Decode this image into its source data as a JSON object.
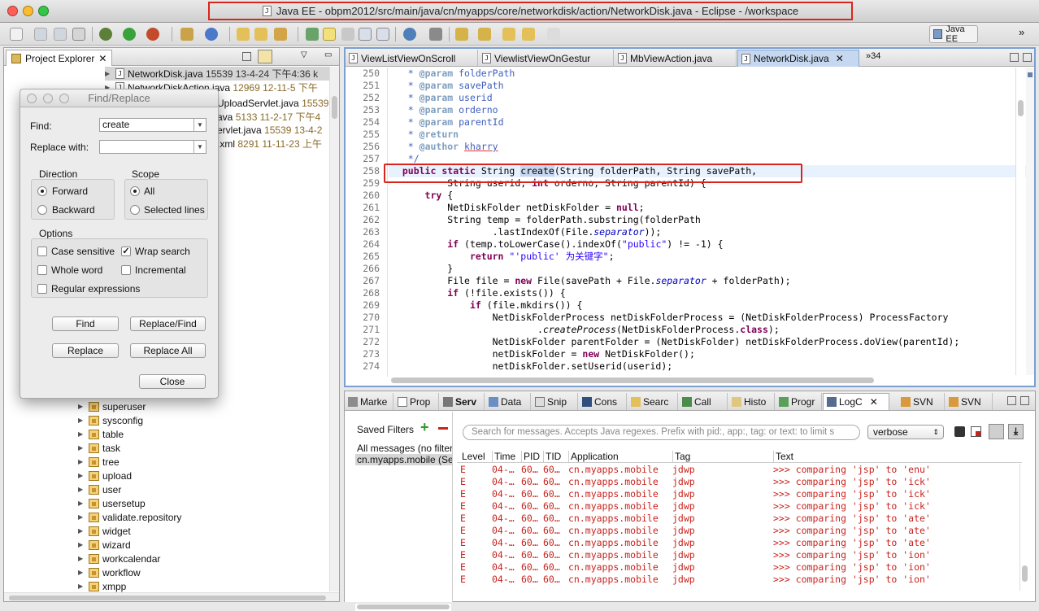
{
  "window": {
    "title": "Java EE - obpm2012/src/main/java/cn/myapps/core/networkdisk/action/NetworkDisk.java - Eclipse - /workspace",
    "perspective": "Java EE"
  },
  "colors": {
    "accent_red": "#d9261c",
    "error_red": "#c8231d",
    "keyword": "#7f0055",
    "comment": "#3f5fbf"
  },
  "project_explorer": {
    "title": "Project Explorer",
    "files": [
      {
        "name": "NetworkDisk.java",
        "info": "15539  13-4-24 下午4:36  k"
      },
      {
        "name": "NetworkDiskAction.java",
        "info": "12969  12-11-5 下午"
      },
      {
        "name": "UploadServlet.java",
        "info": "15539"
      },
      {
        "name": "ava",
        "info": "5133  11-2-17 下午4"
      },
      {
        "name": "ervlet.java",
        "info": "15539  13-4-2"
      },
      {
        "name": ".xml",
        "info": "8291  11-11-23 上午"
      }
    ],
    "packages": [
      "superuser",
      "sysconfig",
      "table",
      "task",
      "tree",
      "upload",
      "user",
      "usersetup",
      "validate.repository",
      "widget",
      "wizard",
      "workcalendar",
      "workflow",
      "xmpp"
    ]
  },
  "find_dialog": {
    "title": "Find/Replace",
    "find_label": "Find:",
    "find_value": "create",
    "replace_label": "Replace with:",
    "replace_value": "",
    "direction_label": "Direction",
    "forward": "Forward",
    "backward": "Backward",
    "scope_label": "Scope",
    "all": "All",
    "selected_lines": "Selected lines",
    "options_label": "Options",
    "case_sensitive": "Case sensitive",
    "wrap_search": "Wrap search",
    "whole_word": "Whole word",
    "incremental": "Incremental",
    "regex": "Regular expressions",
    "find_btn": "Find",
    "replace_find_btn": "Replace/Find",
    "replace_btn": "Replace",
    "replace_all_btn": "Replace All",
    "close_btn": "Close"
  },
  "editor": {
    "tabs": [
      "ViewListViewOnScroll",
      "ViewlistViewOnGestur",
      "MbViewAction.java",
      "NetworkDisk.java"
    ],
    "overflow": "34",
    "line_numbers": [
      "250",
      "251",
      "252",
      "253",
      "254",
      "255",
      "256",
      "257",
      "258",
      "259",
      "260",
      "261",
      "262",
      "263",
      "264",
      "265",
      "266",
      "267",
      "268",
      "269",
      "270",
      "271",
      "272",
      "273",
      "274"
    ]
  },
  "bottom": {
    "tabs": [
      "Marke",
      "Prop",
      "Serv",
      "Data",
      "Snip",
      "Cons",
      "Searc",
      "Call",
      "Histo",
      "Progr",
      "LogC",
      "SVN",
      "SVN"
    ],
    "saved_filters_label": "Saved Filters",
    "filters": [
      "All messages (no filter",
      "cn.myapps.mobile (Se"
    ],
    "search_placeholder": "Search for messages. Accepts Java regexes. Prefix with pid:, app:, tag: or text: to limit s",
    "level_select": "verbose",
    "log_columns": [
      "Level",
      "Time",
      "PID",
      "TID",
      "Application",
      "Tag",
      "Text"
    ],
    "log_rows": [
      [
        "E",
        "04-…",
        "60…",
        "60…",
        "cn.myapps.mobile",
        "jdwp",
        ">>> comparing 'jsp' to 'enu'"
      ],
      [
        "E",
        "04-…",
        "60…",
        "60…",
        "cn.myapps.mobile",
        "jdwp",
        ">>> comparing 'jsp' to 'ick'"
      ],
      [
        "E",
        "04-…",
        "60…",
        "60…",
        "cn.myapps.mobile",
        "jdwp",
        ">>> comparing 'jsp' to 'ick'"
      ],
      [
        "E",
        "04-…",
        "60…",
        "60…",
        "cn.myapps.mobile",
        "jdwp",
        ">>> comparing 'jsp' to 'ick'"
      ],
      [
        "E",
        "04-…",
        "60…",
        "60…",
        "cn.myapps.mobile",
        "jdwp",
        ">>> comparing 'jsp' to 'ate'"
      ],
      [
        "E",
        "04-…",
        "60…",
        "60…",
        "cn.myapps.mobile",
        "jdwp",
        ">>> comparing 'jsp' to 'ate'"
      ],
      [
        "E",
        "04-…",
        "60…",
        "60…",
        "cn.myapps.mobile",
        "jdwp",
        ">>> comparing 'jsp' to 'ate'"
      ],
      [
        "E",
        "04-…",
        "60…",
        "60…",
        "cn.myapps.mobile",
        "jdwp",
        ">>> comparing 'jsp' to 'ion'"
      ],
      [
        "E",
        "04-…",
        "60…",
        "60…",
        "cn.myapps.mobile",
        "jdwp",
        ">>> comparing 'jsp' to 'ion'"
      ],
      [
        "E",
        "04-…",
        "60…",
        "60…",
        "cn.myapps.mobile",
        "jdwp",
        ">>> comparing 'jsp' to 'ion'"
      ]
    ]
  }
}
